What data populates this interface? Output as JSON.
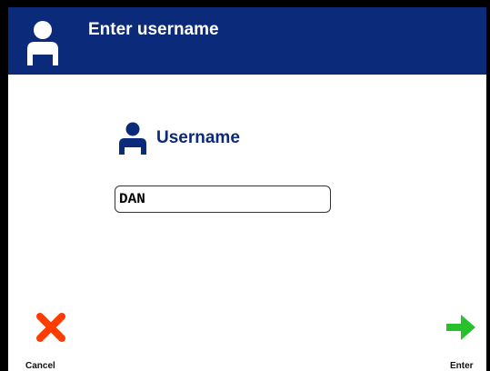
{
  "header": {
    "title": "Enter username",
    "icon": "user-icon"
  },
  "form": {
    "label": "Username",
    "label_icon": "user-icon",
    "username_value": "DAN"
  },
  "actions": {
    "cancel_label": "Cancel",
    "cancel_icon": "x-icon",
    "enter_label": "Enter",
    "enter_icon": "arrow-right-icon"
  },
  "colors": {
    "header_bg": "#0c2a7a",
    "label_color": "#0c2a7a",
    "cancel_color": "#ff3d00",
    "enter_color": "#27c22b"
  }
}
